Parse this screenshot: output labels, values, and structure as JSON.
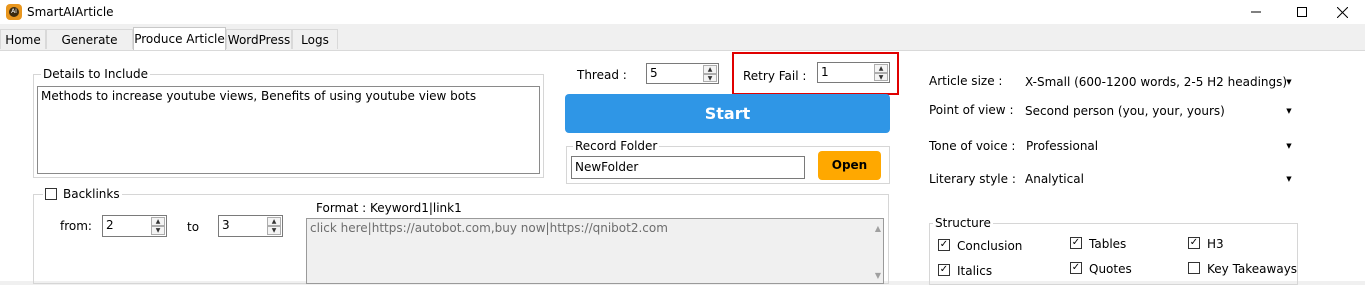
{
  "window": {
    "title": "SmartAIArticle",
    "icon": "app-logo-icon",
    "controls": [
      "minimize-icon",
      "maximize-icon",
      "close-icon"
    ]
  },
  "tabs": [
    {
      "label": "Home"
    },
    {
      "label": "Generate Title"
    },
    {
      "label": "Produce Article"
    },
    {
      "label": "WordPress"
    },
    {
      "label": "Logs"
    }
  ],
  "details": {
    "legend": "Details to Include",
    "text": "Methods to increase youtube views, Benefits of using youtube view bots"
  },
  "thread": {
    "label": "Thread :",
    "value": "5"
  },
  "retry": {
    "label": "Retry Fail :",
    "value": "1"
  },
  "start_label": "Start",
  "record": {
    "legend": "Record Folder",
    "value": "NewFolder",
    "open_label": "Open"
  },
  "backlinks": {
    "legend": "Backlinks",
    "checked": false,
    "from_label": "from:",
    "from_value": "2",
    "to_label": "to",
    "to_value": "3",
    "format_label": "Format : Keyword1|link1",
    "links_text": "click here|https://autobot.com,buy now|https://qnibot2.com"
  },
  "settings": {
    "article_size": {
      "label": "Article size :",
      "value": "X-Small (600-1200 words, 2-5 H2 headings)"
    },
    "point_of_view": {
      "label": "Point of view :",
      "value": "Second person (you, your, yours)"
    },
    "tone": {
      "label": "Tone of voice :",
      "value": "Professional"
    },
    "literary": {
      "label": "Literary style :",
      "value": "Analytical"
    }
  },
  "structure": {
    "legend": "Structure",
    "items": [
      {
        "label": "Conclusion",
        "checked": true
      },
      {
        "label": "Tables",
        "checked": true
      },
      {
        "label": "H3",
        "checked": true
      },
      {
        "label": "Italics",
        "checked": true
      },
      {
        "label": "Quotes",
        "checked": true
      },
      {
        "label": "Key Takeaways",
        "checked": false
      }
    ]
  },
  "colors": {
    "start": "#2f96e6",
    "open": "#ffa800",
    "highlight": "#e00000"
  }
}
